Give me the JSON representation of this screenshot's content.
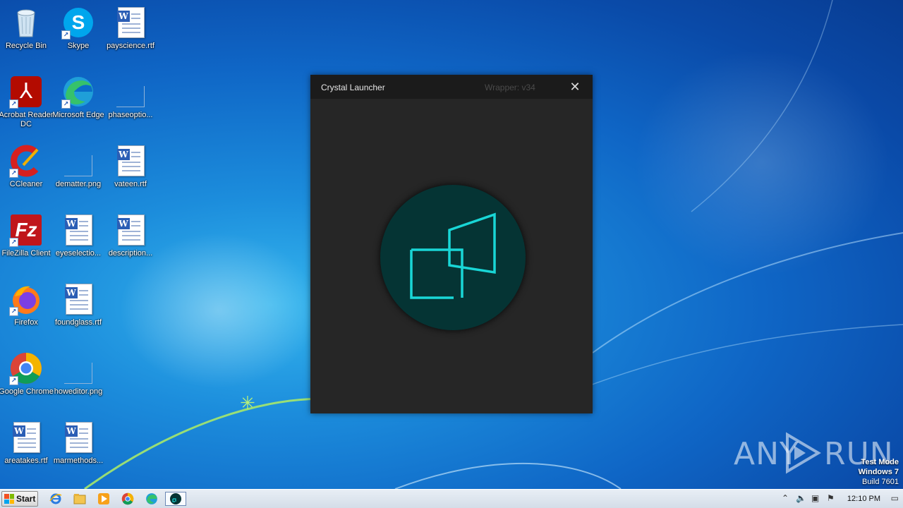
{
  "desktop": {
    "icons": [
      {
        "label": "Recycle Bin"
      },
      {
        "label": "Skype"
      },
      {
        "label": "payscience.rtf"
      },
      {
        "label": "Acrobat Reader DC"
      },
      {
        "label": "Microsoft Edge"
      },
      {
        "label": "phaseoptio..."
      },
      {
        "label": "CCleaner"
      },
      {
        "label": "dematter.png"
      },
      {
        "label": "vateen.rtf"
      },
      {
        "label": "FileZilla Client"
      },
      {
        "label": "eyeselectio..."
      },
      {
        "label": "description..."
      },
      {
        "label": "Firefox"
      },
      {
        "label": "foundglass.rtf"
      },
      {
        "label": "Google Chrome"
      },
      {
        "label": "howeditor.png"
      },
      {
        "label": "areatakes.rtf"
      },
      {
        "label": "marmethods..."
      }
    ]
  },
  "launcher": {
    "title": "Crystal Launcher",
    "version": "Wrapper: v34",
    "close_glyph": "✕",
    "logo_color": "#19d6d6"
  },
  "watermark": {
    "brand_left": "ANY",
    "brand_right": "RUN"
  },
  "system": {
    "test_mode": "Test Mode",
    "os": "Windows 7",
    "build": "Build 7601"
  },
  "taskbar": {
    "start_label": "Start",
    "clock": "12:10 PM"
  }
}
